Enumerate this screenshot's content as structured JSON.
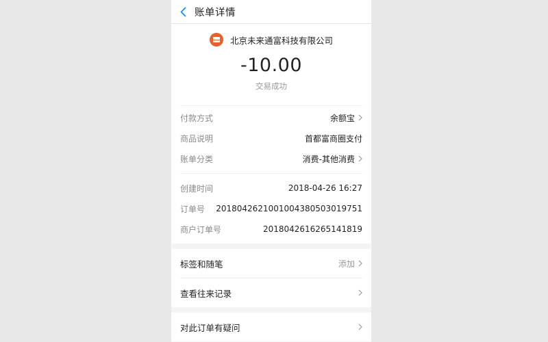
{
  "header": {
    "title": "账单详情"
  },
  "merchant": {
    "name": "北京未来通富科技有限公司"
  },
  "amount": "-10.00",
  "status": "交易成功",
  "details": [
    {
      "label": "付款方式",
      "value": "余额宝",
      "chevron": true
    },
    {
      "label": "商品说明",
      "value": "首都富商圈支付",
      "chevron": false
    },
    {
      "label": "账单分类",
      "value": "消费-其他消费",
      "chevron": true
    }
  ],
  "meta": [
    {
      "label": "创建时间",
      "value": "2018-04-26 16:27"
    },
    {
      "label": "订单号",
      "value": "20180426210010043805030197​51"
    },
    {
      "label": "商户订单号",
      "value": "2018042616265141819"
    }
  ],
  "actions1": [
    {
      "label": "标签和随笔",
      "hint": "添加"
    },
    {
      "label": "查看往来记录",
      "hint": ""
    }
  ],
  "actions2": [
    {
      "label": "对此订单有疑问",
      "hint": ""
    }
  ],
  "colors": {
    "accent": "#1a8cff",
    "merchant_logo": "#e8612c"
  }
}
